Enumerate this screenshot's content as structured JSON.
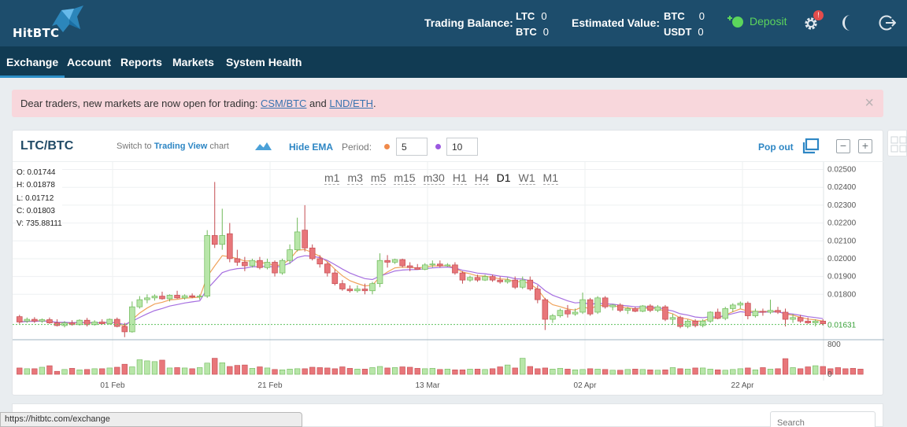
{
  "header": {
    "logo": "HitBTC",
    "trading_balance_label": "Trading Balance:",
    "trading_balance": [
      {
        "cur": "LTC",
        "val": "0"
      },
      {
        "cur": "BTC",
        "val": "0"
      }
    ],
    "estimated_value_label": "Estimated Value:",
    "estimated_value": [
      {
        "cur": "BTC",
        "val": "0"
      },
      {
        "cur": "USDT",
        "val": "0"
      }
    ],
    "deposit_label": "Deposit",
    "notification_badge": "!",
    "accent": "#5cd55c"
  },
  "nav": {
    "items": [
      "Exchange",
      "Account",
      "Reports",
      "Markets",
      "System Health"
    ],
    "active": "Exchange"
  },
  "alert": {
    "text_before": "Dear traders, new markets are now open for trading: ",
    "link1": "CSM/BTC",
    "text_mid": " and ",
    "link2": "LND/ETH",
    "text_after": ".",
    "close": "×"
  },
  "chart_panel": {
    "pair": "LTC/BTC",
    "switch_prefix": "Switch to ",
    "switch_link": "Trading View",
    "switch_suffix": " chart",
    "hide_ema": "Hide EMA",
    "period_label": "Period:",
    "period_1": "5",
    "period_2": "10",
    "ema_colors": {
      "period_1": "#f08a4b",
      "period_2": "#9b59e0"
    },
    "pop_out": "Pop out",
    "minus": "−",
    "plus": "+",
    "ohlc": {
      "open": "O: 0.01744",
      "high": "H: 0.01878",
      "low": "L: 0.01712",
      "close": "C: 0.01803",
      "volume": "V: 735.88111"
    },
    "timeframes": [
      "m1",
      "m3",
      "m5",
      "m15",
      "m30",
      "H1",
      "H4",
      "D1",
      "W1",
      "M1"
    ],
    "selected_timeframe": "D1"
  },
  "chart_data": {
    "type": "candlestick",
    "y_ticks": [
      "0.02500",
      "0.02400",
      "0.02300",
      "0.02200",
      "0.02100",
      "0.02000",
      "0.01900",
      "0.01800"
    ],
    "ylim": [
      0.0155,
      0.0252
    ],
    "current_price": "0.01631",
    "volume_ticks": [
      "800",
      "0"
    ],
    "volume_lim": [
      0,
      800
    ],
    "x_ticks": [
      "01 Feb",
      "21 Feb",
      "13 Mar",
      "02 Apr",
      "22 Apr"
    ],
    "colors": {
      "up": "#b8e6a9",
      "up_border": "#6fb95a",
      "down": "#e8767a",
      "down_border": "#c44c51",
      "ema_short": "#f0a35c",
      "ema_long": "#a66fe0",
      "last_price": "#5dc15d"
    },
    "candles": [
      {
        "o": 0.01675,
        "h": 0.01685,
        "l": 0.01635,
        "c": 0.01645
      },
      {
        "o": 0.0165,
        "h": 0.0167,
        "l": 0.0164,
        "c": 0.0166
      },
      {
        "o": 0.0166,
        "h": 0.01672,
        "l": 0.0164,
        "c": 0.0165
      },
      {
        "o": 0.0165,
        "h": 0.01665,
        "l": 0.0164,
        "c": 0.01658
      },
      {
        "o": 0.01658,
        "h": 0.0167,
        "l": 0.01635,
        "c": 0.0164
      },
      {
        "o": 0.0164,
        "h": 0.0166,
        "l": 0.0162,
        "c": 0.01625
      },
      {
        "o": 0.01625,
        "h": 0.0165,
        "l": 0.01615,
        "c": 0.0164
      },
      {
        "o": 0.0164,
        "h": 0.01655,
        "l": 0.01625,
        "c": 0.0163
      },
      {
        "o": 0.0163,
        "h": 0.0166,
        "l": 0.01625,
        "c": 0.01655
      },
      {
        "o": 0.01655,
        "h": 0.01668,
        "l": 0.0162,
        "c": 0.0163
      },
      {
        "o": 0.0163,
        "h": 0.01655,
        "l": 0.01625,
        "c": 0.01645
      },
      {
        "o": 0.01645,
        "h": 0.0166,
        "l": 0.0163,
        "c": 0.01635
      },
      {
        "o": 0.01635,
        "h": 0.01665,
        "l": 0.0163,
        "c": 0.0166
      },
      {
        "o": 0.0166,
        "h": 0.0167,
        "l": 0.01615,
        "c": 0.0162
      },
      {
        "o": 0.0162,
        "h": 0.0164,
        "l": 0.0156,
        "c": 0.0159
      },
      {
        "o": 0.0159,
        "h": 0.0176,
        "l": 0.01585,
        "c": 0.0173
      },
      {
        "o": 0.0173,
        "h": 0.0179,
        "l": 0.0172,
        "c": 0.0177
      },
      {
        "o": 0.0177,
        "h": 0.018,
        "l": 0.0175,
        "c": 0.0178
      },
      {
        "o": 0.0178,
        "h": 0.018,
        "l": 0.01765,
        "c": 0.0179
      },
      {
        "o": 0.0179,
        "h": 0.01815,
        "l": 0.0177,
        "c": 0.01775
      },
      {
        "o": 0.01775,
        "h": 0.018,
        "l": 0.0176,
        "c": 0.01795
      },
      {
        "o": 0.01795,
        "h": 0.0182,
        "l": 0.01775,
        "c": 0.0178
      },
      {
        "o": 0.0178,
        "h": 0.018,
        "l": 0.0177,
        "c": 0.01792
      },
      {
        "o": 0.01792,
        "h": 0.01805,
        "l": 0.01778,
        "c": 0.01785
      },
      {
        "o": 0.01785,
        "h": 0.018,
        "l": 0.0177,
        "c": 0.0179
      },
      {
        "o": 0.0179,
        "h": 0.0216,
        "l": 0.0178,
        "c": 0.0213
      },
      {
        "o": 0.0213,
        "h": 0.0243,
        "l": 0.0206,
        "c": 0.0208
      },
      {
        "o": 0.0208,
        "h": 0.0228,
        "l": 0.0205,
        "c": 0.0213
      },
      {
        "o": 0.0214,
        "h": 0.022,
        "l": 0.0198,
        "c": 0.02
      },
      {
        "o": 0.02,
        "h": 0.0205,
        "l": 0.0196,
        "c": 0.0198
      },
      {
        "o": 0.0198,
        "h": 0.0201,
        "l": 0.0193,
        "c": 0.0196
      },
      {
        "o": 0.0196,
        "h": 0.02,
        "l": 0.0195,
        "c": 0.0199
      },
      {
        "o": 0.0199,
        "h": 0.0201,
        "l": 0.0194,
        "c": 0.0195
      },
      {
        "o": 0.0195,
        "h": 0.02,
        "l": 0.0194,
        "c": 0.0198
      },
      {
        "o": 0.0198,
        "h": 0.0199,
        "l": 0.019,
        "c": 0.0192
      },
      {
        "o": 0.0192,
        "h": 0.02,
        "l": 0.0191,
        "c": 0.0199
      },
      {
        "o": 0.0199,
        "h": 0.0208,
        "l": 0.0197,
        "c": 0.0205
      },
      {
        "o": 0.0205,
        "h": 0.0223,
        "l": 0.0204,
        "c": 0.0215
      },
      {
        "o": 0.0216,
        "h": 0.023,
        "l": 0.0204,
        "c": 0.0206
      },
      {
        "o": 0.0206,
        "h": 0.0208,
        "l": 0.0199,
        "c": 0.02
      },
      {
        "o": 0.02,
        "h": 0.0202,
        "l": 0.0195,
        "c": 0.0197
      },
      {
        "o": 0.0197,
        "h": 0.0198,
        "l": 0.019,
        "c": 0.0192
      },
      {
        "o": 0.0192,
        "h": 0.0194,
        "l": 0.0185,
        "c": 0.0186
      },
      {
        "o": 0.0186,
        "h": 0.0188,
        "l": 0.0182,
        "c": 0.0183
      },
      {
        "o": 0.0183,
        "h": 0.0185,
        "l": 0.0181,
        "c": 0.0182
      },
      {
        "o": 0.0182,
        "h": 0.0185,
        "l": 0.0181,
        "c": 0.0183
      },
      {
        "o": 0.0183,
        "h": 0.0186,
        "l": 0.018,
        "c": 0.0182
      },
      {
        "o": 0.0182,
        "h": 0.0187,
        "l": 0.018,
        "c": 0.0186
      },
      {
        "o": 0.0186,
        "h": 0.0203,
        "l": 0.0184,
        "c": 0.0199
      },
      {
        "o": 0.0199,
        "h": 0.0202,
        "l": 0.0195,
        "c": 0.0198
      },
      {
        "o": 0.0198,
        "h": 0.02,
        "l": 0.0197,
        "c": 0.01995
      },
      {
        "o": 0.01995,
        "h": 0.02,
        "l": 0.0195,
        "c": 0.0196
      },
      {
        "o": 0.0196,
        "h": 0.0198,
        "l": 0.0193,
        "c": 0.0195
      },
      {
        "o": 0.0195,
        "h": 0.0197,
        "l": 0.0194,
        "c": 0.0194
      },
      {
        "o": 0.0194,
        "h": 0.01975,
        "l": 0.01935,
        "c": 0.01965
      },
      {
        "o": 0.01965,
        "h": 0.0199,
        "l": 0.0195,
        "c": 0.0197
      },
      {
        "o": 0.0197,
        "h": 0.0199,
        "l": 0.0195,
        "c": 0.0196
      },
      {
        "o": 0.0196,
        "h": 0.01975,
        "l": 0.01955,
        "c": 0.01965
      },
      {
        "o": 0.01965,
        "h": 0.0198,
        "l": 0.0191,
        "c": 0.0192
      },
      {
        "o": 0.0192,
        "h": 0.0193,
        "l": 0.0186,
        "c": 0.0188
      },
      {
        "o": 0.0188,
        "h": 0.01905,
        "l": 0.0187,
        "c": 0.01895
      },
      {
        "o": 0.01895,
        "h": 0.0191,
        "l": 0.0187,
        "c": 0.0188
      },
      {
        "o": 0.0188,
        "h": 0.0191,
        "l": 0.01875,
        "c": 0.019
      },
      {
        "o": 0.019,
        "h": 0.0191,
        "l": 0.0187,
        "c": 0.0188
      },
      {
        "o": 0.0188,
        "h": 0.019,
        "l": 0.0186,
        "c": 0.0187
      },
      {
        "o": 0.0187,
        "h": 0.01895,
        "l": 0.0186,
        "c": 0.0188
      },
      {
        "o": 0.0188,
        "h": 0.019,
        "l": 0.0183,
        "c": 0.0184
      },
      {
        "o": 0.0184,
        "h": 0.019,
        "l": 0.0183,
        "c": 0.0188
      },
      {
        "o": 0.0188,
        "h": 0.019,
        "l": 0.0182,
        "c": 0.0183
      },
      {
        "o": 0.0183,
        "h": 0.0185,
        "l": 0.0175,
        "c": 0.0177
      },
      {
        "o": 0.0177,
        "h": 0.0178,
        "l": 0.016,
        "c": 0.0166
      },
      {
        "o": 0.0166,
        "h": 0.0169,
        "l": 0.0164,
        "c": 0.0168
      },
      {
        "o": 0.0168,
        "h": 0.0172,
        "l": 0.0167,
        "c": 0.0171
      },
      {
        "o": 0.0171,
        "h": 0.0174,
        "l": 0.0167,
        "c": 0.0169
      },
      {
        "o": 0.0169,
        "h": 0.0172,
        "l": 0.0168,
        "c": 0.017
      },
      {
        "o": 0.017,
        "h": 0.0181,
        "l": 0.0169,
        "c": 0.0177
      },
      {
        "o": 0.0177,
        "h": 0.0178,
        "l": 0.0168,
        "c": 0.0169
      },
      {
        "o": 0.017,
        "h": 0.0179,
        "l": 0.0169,
        "c": 0.0178
      },
      {
        "o": 0.0178,
        "h": 0.0179,
        "l": 0.0172,
        "c": 0.0173
      },
      {
        "o": 0.0173,
        "h": 0.01745,
        "l": 0.0171,
        "c": 0.0174
      },
      {
        "o": 0.0174,
        "h": 0.0175,
        "l": 0.017,
        "c": 0.0171
      },
      {
        "o": 0.0171,
        "h": 0.0173,
        "l": 0.0169,
        "c": 0.0172
      },
      {
        "o": 0.0172,
        "h": 0.0173,
        "l": 0.017,
        "c": 0.01705
      },
      {
        "o": 0.01705,
        "h": 0.0174,
        "l": 0.017,
        "c": 0.01735
      },
      {
        "o": 0.01735,
        "h": 0.01745,
        "l": 0.017,
        "c": 0.0171
      },
      {
        "o": 0.0171,
        "h": 0.0174,
        "l": 0.017,
        "c": 0.0173
      },
      {
        "o": 0.0173,
        "h": 0.0174,
        "l": 0.0165,
        "c": 0.0166
      },
      {
        "o": 0.0166,
        "h": 0.0169,
        "l": 0.0163,
        "c": 0.0167
      },
      {
        "o": 0.0167,
        "h": 0.0168,
        "l": 0.0161,
        "c": 0.0162
      },
      {
        "o": 0.0162,
        "h": 0.0166,
        "l": 0.0161,
        "c": 0.0165
      },
      {
        "o": 0.0165,
        "h": 0.0166,
        "l": 0.01615,
        "c": 0.01625
      },
      {
        "o": 0.01625,
        "h": 0.0166,
        "l": 0.01615,
        "c": 0.0165
      },
      {
        "o": 0.0165,
        "h": 0.01705,
        "l": 0.0164,
        "c": 0.017
      },
      {
        "o": 0.017,
        "h": 0.0172,
        "l": 0.0166,
        "c": 0.01665
      },
      {
        "o": 0.01665,
        "h": 0.0173,
        "l": 0.01655,
        "c": 0.0172
      },
      {
        "o": 0.0172,
        "h": 0.0175,
        "l": 0.017,
        "c": 0.0174
      },
      {
        "o": 0.0174,
        "h": 0.0176,
        "l": 0.0172,
        "c": 0.0175
      },
      {
        "o": 0.0175,
        "h": 0.0176,
        "l": 0.0166,
        "c": 0.0168
      },
      {
        "o": 0.0168,
        "h": 0.0172,
        "l": 0.0167,
        "c": 0.01705
      },
      {
        "o": 0.01705,
        "h": 0.0172,
        "l": 0.0168,
        "c": 0.017
      },
      {
        "o": 0.017,
        "h": 0.0177,
        "l": 0.0169,
        "c": 0.0171
      },
      {
        "o": 0.0171,
        "h": 0.0173,
        "l": 0.0169,
        "c": 0.017
      },
      {
        "o": 0.017,
        "h": 0.0172,
        "l": 0.0162,
        "c": 0.0166
      },
      {
        "o": 0.0166,
        "h": 0.0169,
        "l": 0.0164,
        "c": 0.0167
      },
      {
        "o": 0.0167,
        "h": 0.01685,
        "l": 0.0164,
        "c": 0.0165
      },
      {
        "o": 0.0165,
        "h": 0.0167,
        "l": 0.01635,
        "c": 0.0164
      },
      {
        "o": 0.0164,
        "h": 0.0166,
        "l": 0.0162,
        "c": 0.0165
      },
      {
        "o": 0.0165,
        "h": 0.0166,
        "l": 0.01625,
        "c": 0.01635
      }
    ],
    "volumes": [
      170,
      150,
      150,
      190,
      230,
      80,
      130,
      160,
      120,
      130,
      150,
      150,
      170,
      190,
      270,
      200,
      390,
      360,
      340,
      380,
      170,
      180,
      170,
      150,
      180,
      300,
      430,
      310,
      210,
      240,
      250,
      160,
      200,
      170,
      130,
      120,
      140,
      150,
      150,
      190,
      180,
      170,
      150,
      200,
      160,
      140,
      140,
      180,
      210,
      170,
      180,
      200,
      190,
      160,
      150,
      160,
      130,
      140,
      120,
      120,
      140,
      140,
      130,
      150,
      200,
      250,
      170,
      430,
      210,
      150,
      170,
      140,
      160,
      140,
      120,
      130,
      150,
      140,
      130,
      110,
      110,
      130,
      140,
      130,
      120,
      110,
      120,
      180,
      150,
      140,
      170,
      170,
      140,
      120,
      110,
      130,
      150,
      170,
      120,
      180,
      140,
      150,
      420,
      180,
      150,
      200,
      230,
      210,
      150,
      180,
      150,
      160,
      140
    ]
  },
  "status_url": "https://hitbtc.com/exchange",
  "search_placeholder": "Search"
}
